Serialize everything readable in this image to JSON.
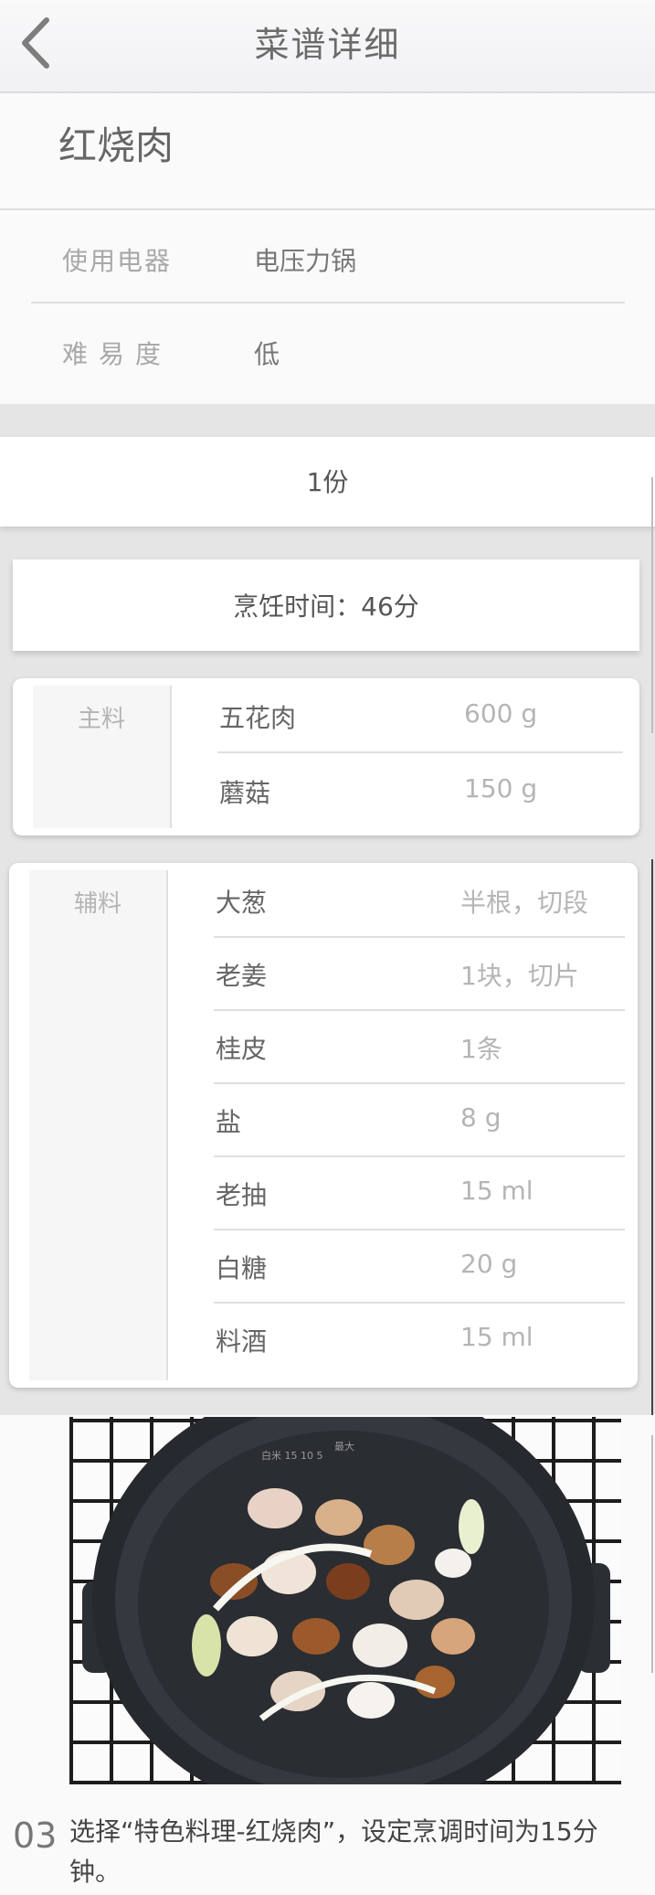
{
  "header": {
    "title": "菜谱详细",
    "back_icon": "chevron-left-icon"
  },
  "recipe": {
    "name": "红烧肉"
  },
  "info": [
    {
      "label": "使用电器",
      "value": "电压力锅"
    },
    {
      "label": "难易度",
      "value": "低"
    }
  ],
  "servings": "1份",
  "cook_time": "烹饪时间：46分",
  "main_ingredients": {
    "title": "主料",
    "items": [
      {
        "name": "五花肉",
        "qty": "600 g"
      },
      {
        "name": "蘑菇",
        "qty": "150 g"
      }
    ]
  },
  "aux_ingredients": {
    "title": "辅料",
    "items": [
      {
        "name": "大葱",
        "qty": "半根，切段"
      },
      {
        "name": "老姜",
        "qty": "1块，切片"
      },
      {
        "name": "桂皮",
        "qty": "1条"
      },
      {
        "name": "盐",
        "qty": "8 g"
      },
      {
        "name": "老抽",
        "qty": "15 ml"
      },
      {
        "name": "白糖",
        "qty": "20 g"
      },
      {
        "name": "料酒",
        "qty": "15 ml"
      }
    ]
  },
  "step": {
    "number": "03",
    "text": "选择“特色料理-红烧肉”，设定烹调时间为15分钟。"
  },
  "colors": {
    "header_bg": "#f3f3f5",
    "page_bg": "#fafafa",
    "divider": "#dedede"
  }
}
